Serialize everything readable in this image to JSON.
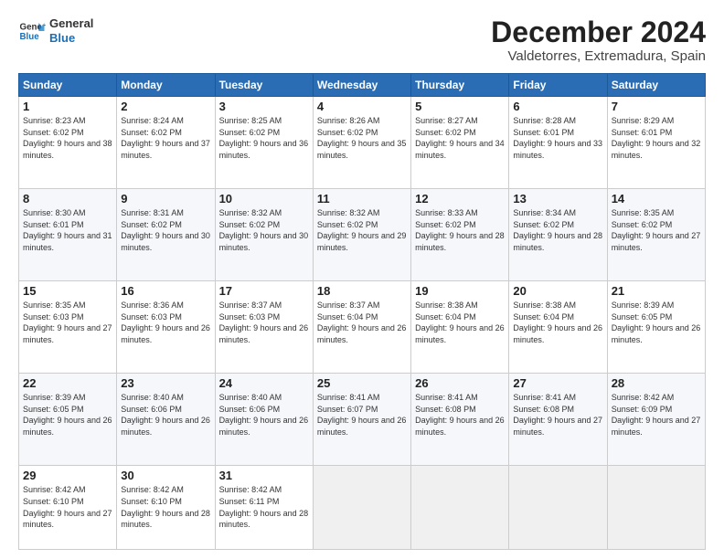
{
  "header": {
    "logo_line1": "General",
    "logo_line2": "Blue",
    "month": "December 2024",
    "location": "Valdetorres, Extremadura, Spain"
  },
  "weekdays": [
    "Sunday",
    "Monday",
    "Tuesday",
    "Wednesday",
    "Thursday",
    "Friday",
    "Saturday"
  ],
  "weeks": [
    [
      {
        "day": "1",
        "info": "Sunrise: 8:23 AM\nSunset: 6:02 PM\nDaylight: 9 hours and 38 minutes."
      },
      {
        "day": "2",
        "info": "Sunrise: 8:24 AM\nSunset: 6:02 PM\nDaylight: 9 hours and 37 minutes."
      },
      {
        "day": "3",
        "info": "Sunrise: 8:25 AM\nSunset: 6:02 PM\nDaylight: 9 hours and 36 minutes."
      },
      {
        "day": "4",
        "info": "Sunrise: 8:26 AM\nSunset: 6:02 PM\nDaylight: 9 hours and 35 minutes."
      },
      {
        "day": "5",
        "info": "Sunrise: 8:27 AM\nSunset: 6:02 PM\nDaylight: 9 hours and 34 minutes."
      },
      {
        "day": "6",
        "info": "Sunrise: 8:28 AM\nSunset: 6:01 PM\nDaylight: 9 hours and 33 minutes."
      },
      {
        "day": "7",
        "info": "Sunrise: 8:29 AM\nSunset: 6:01 PM\nDaylight: 9 hours and 32 minutes."
      }
    ],
    [
      {
        "day": "8",
        "info": "Sunrise: 8:30 AM\nSunset: 6:01 PM\nDaylight: 9 hours and 31 minutes."
      },
      {
        "day": "9",
        "info": "Sunrise: 8:31 AM\nSunset: 6:02 PM\nDaylight: 9 hours and 30 minutes."
      },
      {
        "day": "10",
        "info": "Sunrise: 8:32 AM\nSunset: 6:02 PM\nDaylight: 9 hours and 30 minutes."
      },
      {
        "day": "11",
        "info": "Sunrise: 8:32 AM\nSunset: 6:02 PM\nDaylight: 9 hours and 29 minutes."
      },
      {
        "day": "12",
        "info": "Sunrise: 8:33 AM\nSunset: 6:02 PM\nDaylight: 9 hours and 28 minutes."
      },
      {
        "day": "13",
        "info": "Sunrise: 8:34 AM\nSunset: 6:02 PM\nDaylight: 9 hours and 28 minutes."
      },
      {
        "day": "14",
        "info": "Sunrise: 8:35 AM\nSunset: 6:02 PM\nDaylight: 9 hours and 27 minutes."
      }
    ],
    [
      {
        "day": "15",
        "info": "Sunrise: 8:35 AM\nSunset: 6:03 PM\nDaylight: 9 hours and 27 minutes."
      },
      {
        "day": "16",
        "info": "Sunrise: 8:36 AM\nSunset: 6:03 PM\nDaylight: 9 hours and 26 minutes."
      },
      {
        "day": "17",
        "info": "Sunrise: 8:37 AM\nSunset: 6:03 PM\nDaylight: 9 hours and 26 minutes."
      },
      {
        "day": "18",
        "info": "Sunrise: 8:37 AM\nSunset: 6:04 PM\nDaylight: 9 hours and 26 minutes."
      },
      {
        "day": "19",
        "info": "Sunrise: 8:38 AM\nSunset: 6:04 PM\nDaylight: 9 hours and 26 minutes."
      },
      {
        "day": "20",
        "info": "Sunrise: 8:38 AM\nSunset: 6:04 PM\nDaylight: 9 hours and 26 minutes."
      },
      {
        "day": "21",
        "info": "Sunrise: 8:39 AM\nSunset: 6:05 PM\nDaylight: 9 hours and 26 minutes."
      }
    ],
    [
      {
        "day": "22",
        "info": "Sunrise: 8:39 AM\nSunset: 6:05 PM\nDaylight: 9 hours and 26 minutes."
      },
      {
        "day": "23",
        "info": "Sunrise: 8:40 AM\nSunset: 6:06 PM\nDaylight: 9 hours and 26 minutes."
      },
      {
        "day": "24",
        "info": "Sunrise: 8:40 AM\nSunset: 6:06 PM\nDaylight: 9 hours and 26 minutes."
      },
      {
        "day": "25",
        "info": "Sunrise: 8:41 AM\nSunset: 6:07 PM\nDaylight: 9 hours and 26 minutes."
      },
      {
        "day": "26",
        "info": "Sunrise: 8:41 AM\nSunset: 6:08 PM\nDaylight: 9 hours and 26 minutes."
      },
      {
        "day": "27",
        "info": "Sunrise: 8:41 AM\nSunset: 6:08 PM\nDaylight: 9 hours and 27 minutes."
      },
      {
        "day": "28",
        "info": "Sunrise: 8:42 AM\nSunset: 6:09 PM\nDaylight: 9 hours and 27 minutes."
      }
    ],
    [
      {
        "day": "29",
        "info": "Sunrise: 8:42 AM\nSunset: 6:10 PM\nDaylight: 9 hours and 27 minutes."
      },
      {
        "day": "30",
        "info": "Sunrise: 8:42 AM\nSunset: 6:10 PM\nDaylight: 9 hours and 28 minutes."
      },
      {
        "day": "31",
        "info": "Sunrise: 8:42 AM\nSunset: 6:11 PM\nDaylight: 9 hours and 28 minutes."
      },
      null,
      null,
      null,
      null
    ]
  ]
}
